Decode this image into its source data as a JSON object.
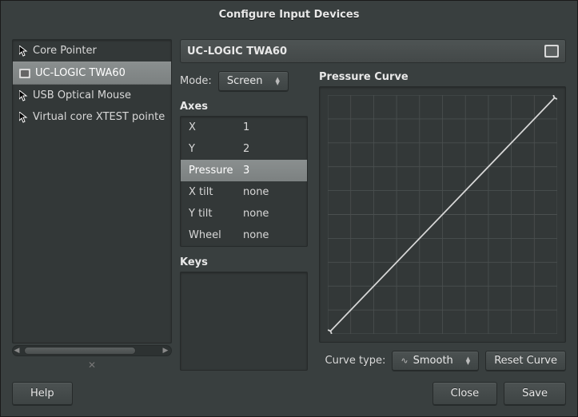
{
  "window": {
    "title": "Configure Input Devices"
  },
  "devices": {
    "items": [
      {
        "label": "Core Pointer",
        "icon": "pointer"
      },
      {
        "label": "UC-LOGIC TWA60",
        "icon": "tablet"
      },
      {
        "label": "USB Optical Mouse",
        "icon": "pointer"
      },
      {
        "label": "Virtual core XTEST pointe",
        "icon": "pointer"
      }
    ],
    "selected_index": 1
  },
  "detail": {
    "header_title": "UC-LOGIC TWA60",
    "mode_label": "Mode:",
    "mode_value": "Screen",
    "axes_label": "Axes",
    "axes_rows": [
      {
        "name": "X",
        "value": "1"
      },
      {
        "name": "Y",
        "value": "2"
      },
      {
        "name": "Pressure",
        "value": "3"
      },
      {
        "name": "X tilt",
        "value": "none"
      },
      {
        "name": "Y tilt",
        "value": "none"
      },
      {
        "name": "Wheel",
        "value": "none"
      }
    ],
    "axes_selected_index": 2,
    "keys_label": "Keys",
    "curve_label": "Pressure Curve",
    "curve_type_label": "Curve type:",
    "curve_type_value": "Smooth",
    "reset_curve_label": "Reset Curve"
  },
  "footer": {
    "help_label": "Help",
    "close_label": "Close",
    "save_label": "Save"
  },
  "chart_data": {
    "type": "line",
    "title": "Pressure Curve",
    "xlabel": "",
    "ylabel": "",
    "xlim": [
      0,
      1
    ],
    "ylim": [
      0,
      1
    ],
    "grid": true,
    "grid_divisions": 10,
    "series": [
      {
        "name": "curve",
        "x": [
          0,
          1
        ],
        "y": [
          0,
          1
        ]
      }
    ],
    "control_points": [
      {
        "x": 0,
        "y": 0
      },
      {
        "x": 1,
        "y": 1
      }
    ]
  }
}
